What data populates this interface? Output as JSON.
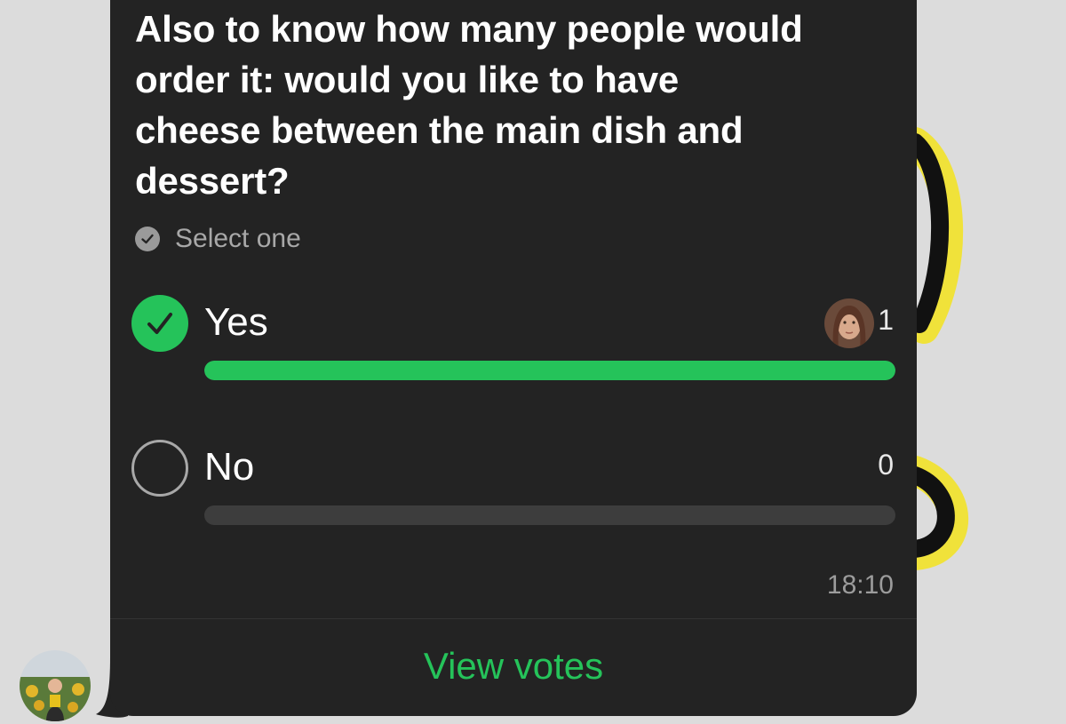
{
  "poll": {
    "question": "Also to know how many people would order it:  would you like to have cheese between the main dish and dessert?",
    "select_hint": "Select one",
    "options": [
      {
        "label": "Yes",
        "votes": "1",
        "selected": true,
        "share": 1.0
      },
      {
        "label": "No",
        "votes": "0",
        "selected": false,
        "share": 0.0
      }
    ],
    "timestamp": "18:10",
    "view_votes_label": "View votes"
  },
  "colors": {
    "bubble": "#232323",
    "accent": "#25c35a",
    "track": "#3d3d3d",
    "chat_background": "#dcdcdc"
  },
  "icons": {
    "hint": "check-circle-icon",
    "selected": "checkmark-icon",
    "unselected": "radio-empty-icon"
  }
}
